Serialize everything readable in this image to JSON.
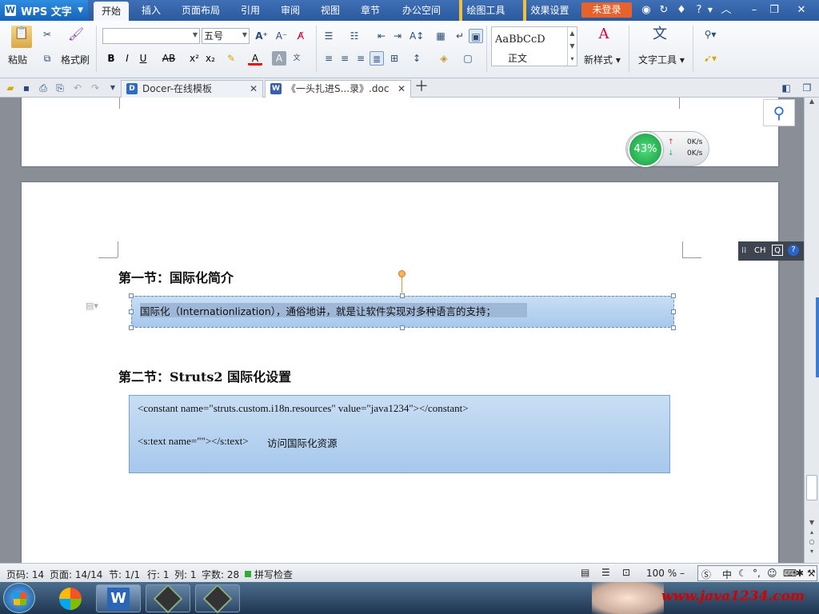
{
  "app": {
    "name": "WPS 文字",
    "login_label": "未登录"
  },
  "menu_tabs": [
    "开始",
    "插入",
    "页面布局",
    "引用",
    "审阅",
    "视图",
    "章节",
    "办公空间",
    "绘图工具",
    "效果设置"
  ],
  "ribbon": {
    "paste": "粘贴",
    "format_painter": "格式刷",
    "font_name": "",
    "font_size": "五号",
    "style_preview": "AaBbCcDc",
    "style_name": "正文",
    "new_style": "新样式",
    "text_tool": "文字工具"
  },
  "doc_tabs": [
    {
      "title": "Docer-在线模板",
      "active": false
    },
    {
      "title": "《一头扎进S...录》.doc",
      "active": true
    }
  ],
  "net_meter": {
    "percent": "43%",
    "upload": "0K/s",
    "download": "0K/s"
  },
  "ime_bar": {
    "label": "CH"
  },
  "document": {
    "section1_title": "第一节：国际化简介",
    "section1_text": "国际化（Internationlization），通俗地讲，就是让软件实现对多种语言的支持；",
    "section2_title": "第二节：Struts2 国际化设置",
    "code_line1": "<constant name=\"struts.custom.i18n.resources\" value=\"java1234\"></constant>",
    "code_line2": "<s:text name=\"\"></s:text>",
    "code_line2_note": "访问国际化资源"
  },
  "status_bar": {
    "page_no": "页码: 14",
    "pages": "页面: 14/14",
    "section": "节: 1/1",
    "row": "行: 1",
    "col": "列: 1",
    "words": "字数: 28",
    "spell": "拼写检查",
    "zoom": "100 %"
  },
  "watermark": "www.java1234.com",
  "colors": {
    "title_bar": "#2b5a9e",
    "login": "#e8622b",
    "text_box": "#b3d0ef",
    "accent_blue": "#3f6fb5"
  }
}
